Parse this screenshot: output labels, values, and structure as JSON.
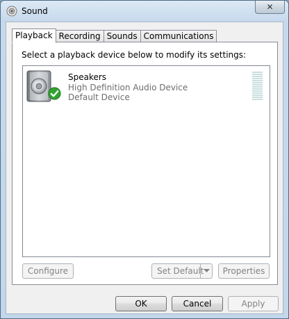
{
  "window": {
    "title": "Sound",
    "close_glyph": "✕"
  },
  "tabs": [
    {
      "label": "Playback",
      "active": true
    },
    {
      "label": "Recording",
      "active": false
    },
    {
      "label": "Sounds",
      "active": false
    },
    {
      "label": "Communications",
      "active": false
    }
  ],
  "playback": {
    "instruction": "Select a playback device below to modify its settings:",
    "devices": [
      {
        "name": "Speakers",
        "description": "High Definition Audio Device",
        "status": "Default Device",
        "icon": "speaker-icon",
        "default_badge": "green-check-icon",
        "level": 0
      }
    ],
    "configure_label": "Configure",
    "set_default_label": "Set Default",
    "properties_label": "Properties"
  },
  "footer": {
    "ok_label": "OK",
    "cancel_label": "Cancel",
    "apply_label": "Apply"
  },
  "colors": {
    "frame": "#c3d6ea",
    "client": "#f0f0f0",
    "disabled_text": "#838383",
    "check_green": "#2fa52f"
  }
}
